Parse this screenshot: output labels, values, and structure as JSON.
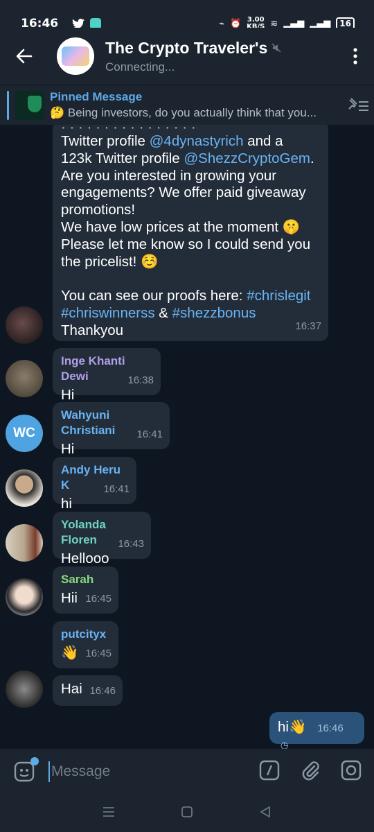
{
  "status_bar": {
    "time": "16:46",
    "network_speed": "3.00\nKB/S",
    "battery": "16"
  },
  "header": {
    "title": "The Crypto Traveler's",
    "subtitle": "Connecting..."
  },
  "pinned": {
    "title": "Pinned Message",
    "message": "🤔 Being investors, do you actually think that you..."
  },
  "messages": {
    "long": {
      "partial_top": "  · · · · · · · · · · · · · ·   · ·",
      "line1_pre": "Twitter profile ",
      "line1_link": "@4dynastyrich",
      "line1_post": " and a",
      "line2_pre": "123k Twitter profile ",
      "line2_link": "@ShezzCryptoGem",
      "line2_post": ".",
      "body1": "Are you interested in growing your engagements? We offer paid giveaway promotions!",
      "body2": "We have low prices at the moment 🤫",
      "body3": "Please let me know so I could send you the pricelist! ☺️",
      "proof_pre": "You can see our proofs here: ",
      "tag1": "#chrislegit",
      "tag2": "#chriswinnerss",
      "amp": " & ",
      "tag3": "#shezzbonus",
      "end": "Thankyou",
      "time": "16:37"
    },
    "m1": {
      "sender": "Inge Khanti Dewi",
      "text": "Hi",
      "time": "16:38",
      "color": "#b39ee8"
    },
    "m2": {
      "sender": "Wahyuni Christiani",
      "text": "Hi",
      "time": "16:41",
      "color": "#6ab3f3",
      "initials": "WC"
    },
    "m3": {
      "sender": "Andy Heru K",
      "text": "hi",
      "time": "16:41",
      "color": "#6ab3f3"
    },
    "m4": {
      "sender": "Yolanda Floren",
      "text": "Hellooo",
      "time": "16:43",
      "color": "#6fd4c0"
    },
    "m5": {
      "sender": "Sarah",
      "text": "Hii",
      "time": "16:45",
      "color": "#8ad97d"
    },
    "m6": {
      "sender": "putcityx",
      "text": "👋",
      "time": "16:45",
      "color": "#6ab3f3"
    },
    "m7": {
      "text": "Hai",
      "time": "16:46"
    },
    "out": {
      "text": "hi👋",
      "time": "16:46"
    }
  },
  "input": {
    "placeholder": "Message"
  }
}
